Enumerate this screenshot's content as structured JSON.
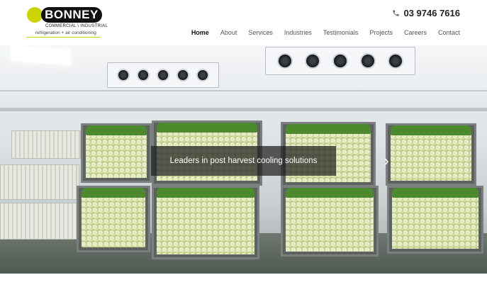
{
  "brand": {
    "name": "BONNEY",
    "tagline_top": "COMMERCIAL \\ INDUSTRIAL",
    "tagline_bottom": "refrigeration + air conditioning",
    "accent_color": "#cbd300"
  },
  "phone": {
    "icon": "phone-icon",
    "number": "03 9746 7616"
  },
  "nav": {
    "items": [
      {
        "label": "Home",
        "active": true
      },
      {
        "label": "About",
        "active": false
      },
      {
        "label": "Services",
        "active": false
      },
      {
        "label": "Industries",
        "active": false
      },
      {
        "label": "Testimonials",
        "active": false
      },
      {
        "label": "Projects",
        "active": false
      },
      {
        "label": "Careers",
        "active": false
      },
      {
        "label": "Contact",
        "active": false
      }
    ]
  },
  "hero": {
    "caption": "Leaders in post harvest cooling solutions",
    "next_icon": "chevron-right-icon",
    "prev_icon": "chevron-left-icon"
  },
  "section": {
    "heading_partial": "Heading text partially visible (cut off)",
    "heading_color": "#c6cf1c"
  }
}
